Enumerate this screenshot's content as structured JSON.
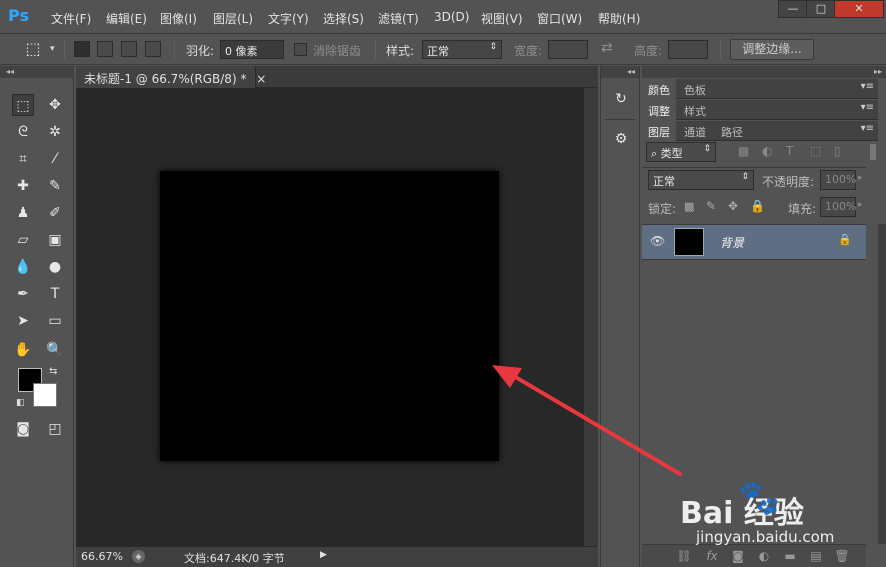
{
  "app": {
    "logo": "Ps"
  },
  "menu": {
    "items": [
      "文件(F)",
      "编辑(E)",
      "图像(I)",
      "图层(L)",
      "文字(Y)",
      "选择(S)",
      "滤镜(T)",
      "3D(D)",
      "视图(V)",
      "窗口(W)",
      "帮助(H)"
    ]
  },
  "window_controls": {
    "minimize": "—",
    "maximize": "□",
    "close": "✕"
  },
  "options": {
    "feather_label": "羽化:",
    "feather_value": "0 像素",
    "antialias_label": "消除锯齿",
    "style_label": "样式:",
    "style_value": "正常",
    "width_label": "宽度:",
    "height_label": "高度:",
    "refine_edge": "调整边缘..."
  },
  "document": {
    "tab_title": "未标题-1 @ 66.7%(RGB/8) *",
    "tab_close": "×",
    "canvas_color": "#000000",
    "zoom": "66.67%",
    "doc_info": "文档:647.4K/0 字节"
  },
  "panels": {
    "group1_tabs": [
      "颜色",
      "色板"
    ],
    "group2_tabs": [
      "调整",
      "样式"
    ],
    "layers_tabs": [
      "图层",
      "通道",
      "路径"
    ],
    "filter_kind": "类型",
    "blend_mode": "正常",
    "opacity_label": "不透明度:",
    "opacity_value": "100%",
    "lock_label": "锁定:",
    "fill_label": "填充:",
    "fill_value": "100%",
    "layer_name": "背景"
  },
  "colors": {
    "foreground": "#000000",
    "background": "#ffffff",
    "arrow": "#e8383d",
    "accent": "#31a8ff"
  },
  "watermark": {
    "logo": "Bai  经验",
    "url": "jingyan.baidu.com"
  }
}
